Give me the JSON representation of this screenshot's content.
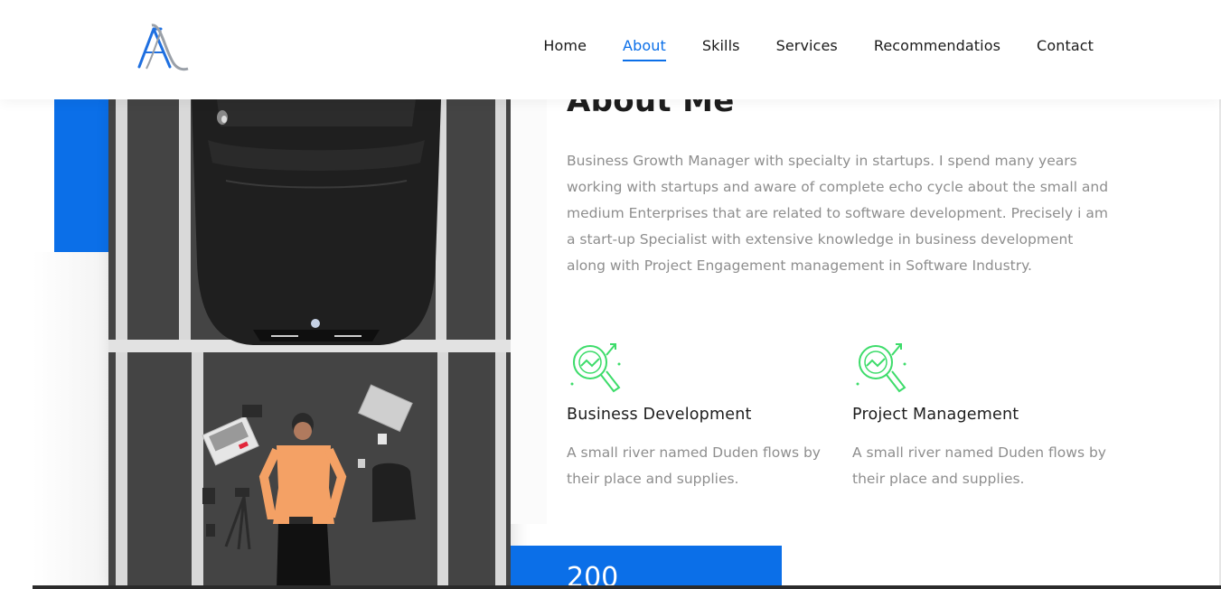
{
  "brand": {
    "logo_icon": "aa-monogram-logo"
  },
  "nav": {
    "items": [
      {
        "label": "Home",
        "active": false
      },
      {
        "label": "About",
        "active": true
      },
      {
        "label": "Skills",
        "active": false
      },
      {
        "label": "Services",
        "active": false
      },
      {
        "label": "Recommendatios",
        "active": false
      },
      {
        "label": "Contact",
        "active": false
      }
    ]
  },
  "colors": {
    "accent": "#0b6fe8",
    "icon_green": "#3ddc6a",
    "body_text": "#8e8e8e",
    "heading": "#1d1d1d"
  },
  "about": {
    "title": "About Me",
    "description": "Business Growth Manager with specialty in startups. I spend many years working with startups and aware of complete echo cycle about the small and medium Enterprises that are related to software development. Precisely i am a start-up Specialist with extensive knowledge in business development along with Project Engagement management in Software Industry.",
    "features": [
      {
        "icon": "analytics-search-icon",
        "title": "Business Development",
        "text": "A small river named Duden flows by their place and supplies."
      },
      {
        "icon": "analytics-search-icon",
        "title": "Project Management",
        "text": "A small river named Duden flows by their place and supplies."
      }
    ],
    "counter": {
      "value": "200"
    }
  }
}
